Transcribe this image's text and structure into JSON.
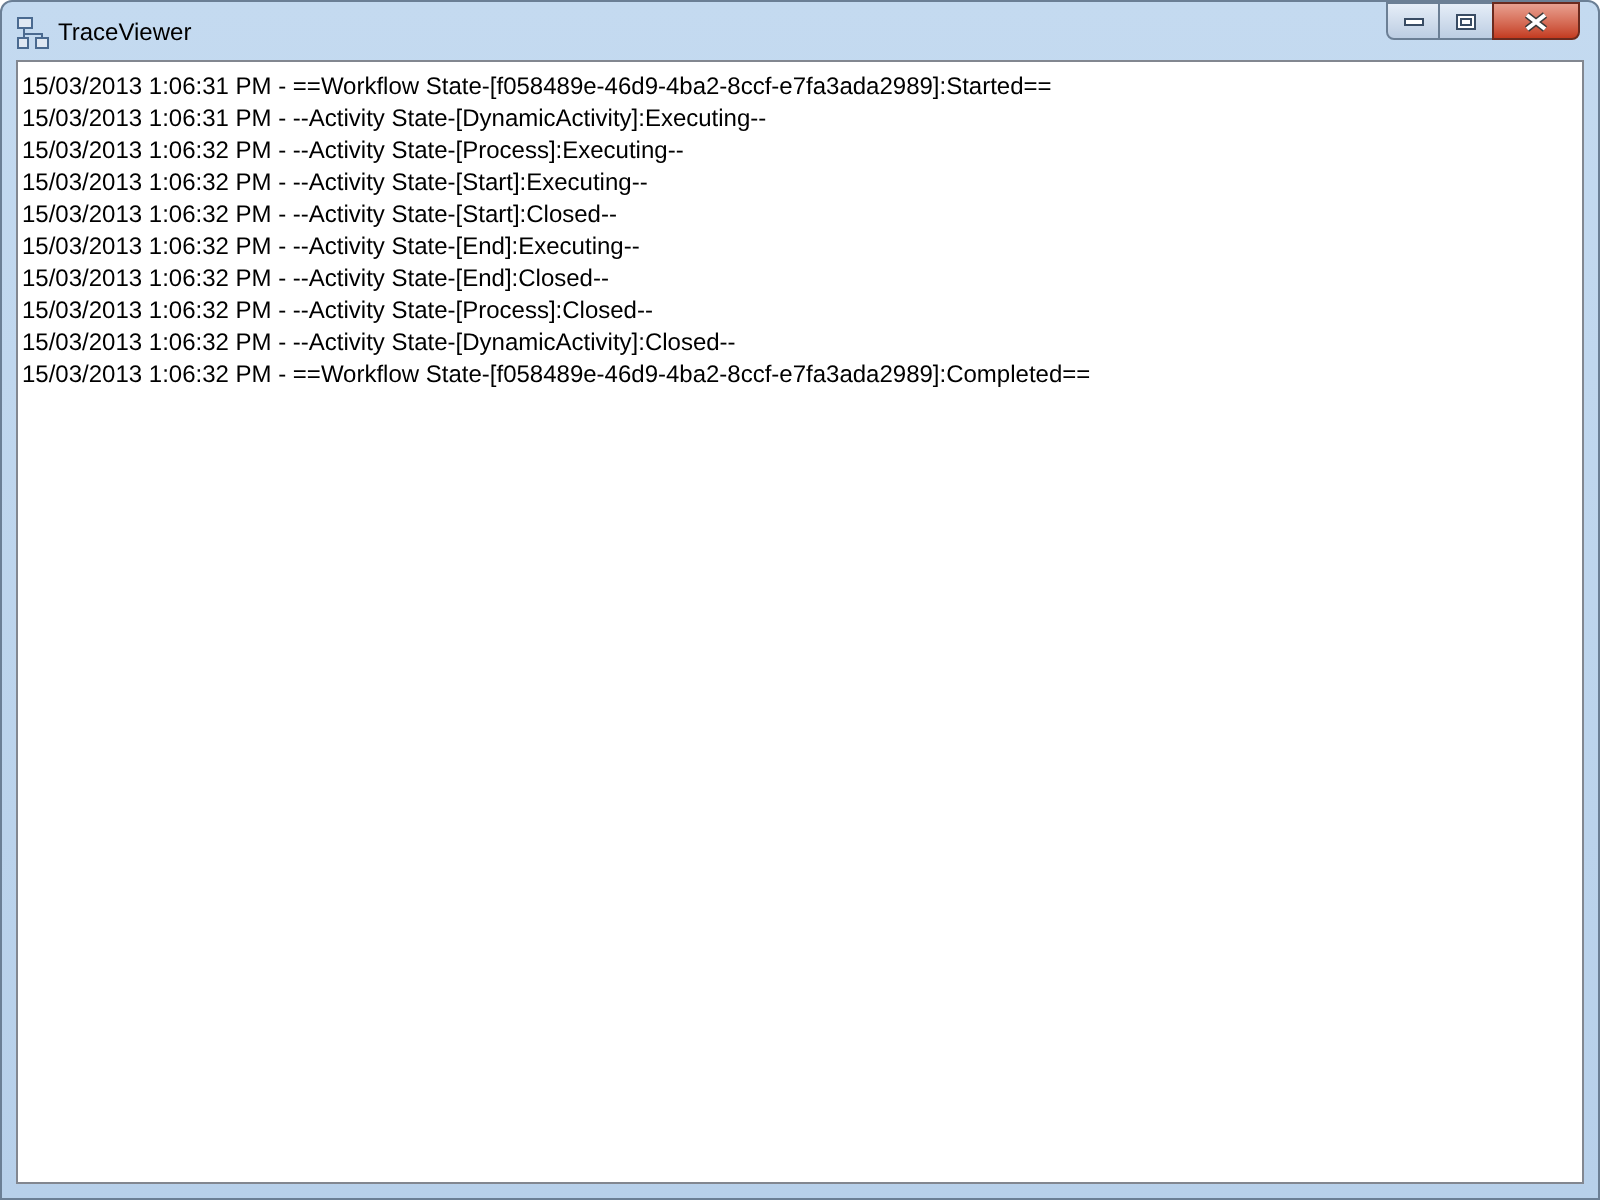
{
  "window": {
    "title": "TraceViewer"
  },
  "log_lines": [
    "15/03/2013 1:06:31 PM - ==Workflow State-[f058489e-46d9-4ba2-8ccf-e7fa3ada2989]:Started==",
    "15/03/2013 1:06:31 PM - --Activity State-[DynamicActivity]:Executing--",
    "15/03/2013 1:06:32 PM - --Activity State-[Process]:Executing--",
    "15/03/2013 1:06:32 PM - --Activity State-[Start]:Executing--",
    "15/03/2013 1:06:32 PM - --Activity State-[Start]:Closed--",
    "15/03/2013 1:06:32 PM - --Activity State-[End]:Executing--",
    "15/03/2013 1:06:32 PM - --Activity State-[End]:Closed--",
    "15/03/2013 1:06:32 PM - --Activity State-[Process]:Closed--",
    "15/03/2013 1:06:32 PM - --Activity State-[DynamicActivity]:Closed--",
    "15/03/2013 1:06:32 PM - ==Workflow State-[f058489e-46d9-4ba2-8ccf-e7fa3ada2989]:Completed=="
  ]
}
